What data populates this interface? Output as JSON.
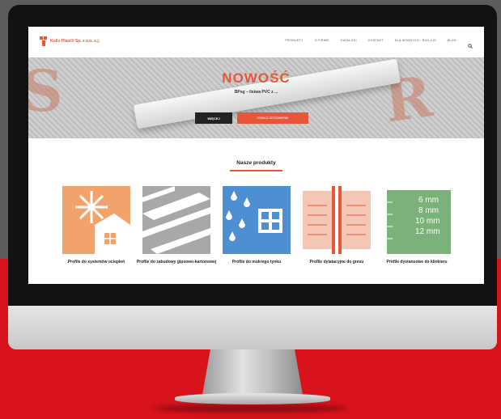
{
  "brand": {
    "name": "Kollo Plast® Sp. z o.o. s.j.",
    "tagline": ""
  },
  "nav": {
    "items": [
      "PRODUKTY",
      "O FIRMIE",
      "KATALOGI",
      "KONTAKT",
      "DLA WODNYCH - BUD-CIS",
      "BLOG"
    ]
  },
  "hero": {
    "title": "NOWOŚĆ",
    "subtitle": "BPsg – listwa PVC z ...",
    "button_more": "WIĘCEJ",
    "button_secondary": "ZOBACZ ZESTAWIENIE"
  },
  "products_section": {
    "title": "Nasze produkty",
    "items": [
      {
        "label": "Profile do systemów ociepleń",
        "icon": "snowflake-house-icon",
        "color": "#f2a36b"
      },
      {
        "label": "Profile do zabudowy gipsowo-kartonowej",
        "icon": "drywall-boards-icon",
        "color": "#a8a8a8"
      },
      {
        "label": "Profile do mokrego tynku",
        "icon": "raindrop-window-icon",
        "color": "#4d8fd0"
      },
      {
        "label": "Profile dylatacyjne do gresu",
        "icon": "expansion-joint-icon",
        "color": "#f3c7b6"
      },
      {
        "label": "Profile dystansowe do klinkieru",
        "icon": "spacer-ruler-icon",
        "color": "#7ab27a"
      }
    ]
  },
  "ruler": {
    "marks": [
      "6 mm",
      "8 mm",
      "10 mm",
      "12 mm"
    ]
  },
  "colors": {
    "accent": "#e8563a",
    "background_red": "#d8131b"
  }
}
